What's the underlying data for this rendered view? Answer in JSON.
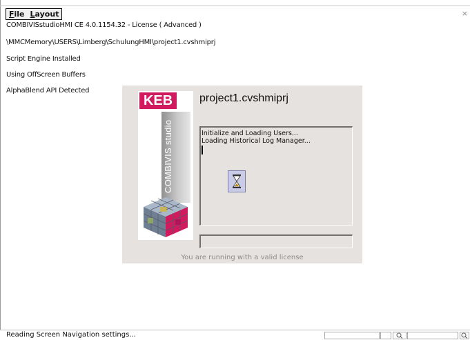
{
  "menu": {
    "items": [
      {
        "label_accel": "F",
        "label_rest": "ile"
      },
      {
        "label_accel": "L",
        "label_rest": "ayout"
      }
    ]
  },
  "window": {
    "close_glyph": "×"
  },
  "log": {
    "lines": [
      "COMBIVISstudioHMI CE 4.0.1154.32 - License ( Advanced )",
      "\\MMCMemory\\USERS\\Limberg\\SchulungHMI\\project1.cvshmiprj",
      "Script Engine Installed",
      "Using OffScreen Buffers",
      "AlphaBlend API Detected"
    ]
  },
  "splash": {
    "brand": "KEB",
    "product_strip": "COMBIVIS studio",
    "project_title": "project1.cvshmiprj",
    "messages": [
      "Initialize and Loading Users...",
      "Loading Historical Log Manager..."
    ],
    "license_text": "You are running with a valid license",
    "brand_color": "#d01c5e"
  },
  "status": {
    "text": "Reading Screen Navigation settings..."
  }
}
